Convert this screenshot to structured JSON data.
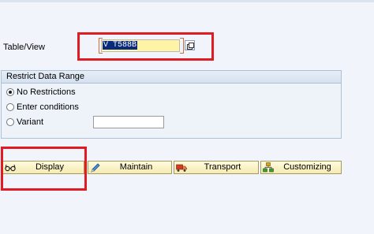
{
  "form": {
    "table_view_label": "Table/View",
    "table_view_value": "V_T588B",
    "table_view_value_display": "V T588B"
  },
  "restrict": {
    "title": "Restrict Data Range",
    "options": [
      {
        "label": "No Restrictions",
        "checked": true
      },
      {
        "label": "Enter conditions",
        "checked": false
      },
      {
        "label": "Variant",
        "checked": false
      }
    ],
    "variant_value": ""
  },
  "buttons": {
    "display": "Display",
    "maintain": "Maintain",
    "transport": "Transport",
    "customizing": "Customizing"
  },
  "icons": {
    "display": "glasses-icon",
    "maintain": "pencil-icon",
    "transport": "truck-icon",
    "customizing": "hierarchy-icon",
    "f4": "value-help-icon"
  },
  "colors": {
    "background": "#f1f5fb",
    "input_highlight": "#fff3a6",
    "selection": "#0a2a7a",
    "annotation_red": "#e01b22",
    "button_fill": "#f5eab0"
  }
}
